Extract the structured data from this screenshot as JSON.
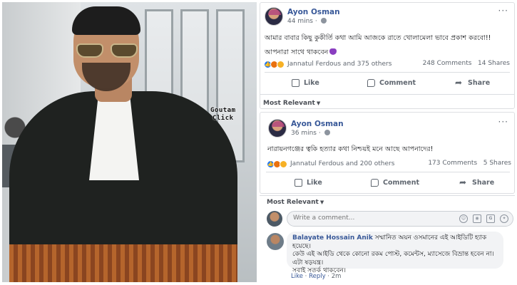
{
  "photo": {
    "watermark_line1": "Goutam",
    "watermark_line2": "Click"
  },
  "post1": {
    "author": "Ayon Osman",
    "time": "44 mins",
    "text_line1": "আমার বাবার কিছু কুকীর্তি কথা আমি আজকে রাতে খোলামেলা ভাবে প্রকাশ করবো!!",
    "text_line2": "আপনারা সাথে থাকবেন",
    "reactions_summary": "Jannatul Ferdous and 375 others",
    "comments_count": "248 Comments",
    "shares_count": "14 Shares",
    "actions": {
      "like": "Like",
      "comment": "Comment",
      "share": "Share"
    },
    "sort_label": "Most Relevant"
  },
  "post2": {
    "author": "Ayon Osman",
    "time": "36 mins",
    "text_line1": "নারায়নগঞ্জের ত্বকি হত্যার কথা নিশ্চয়ই মনে আছে আপনাদের!",
    "reactions_summary": "Jannatul Ferdous and 200 others",
    "comments_count": "173 Comments",
    "shares_count": "5 Shares",
    "actions": {
      "like": "Like",
      "comment": "Comment",
      "share": "Share"
    },
    "sort_label": "Most Relevant"
  },
  "composer": {
    "placeholder": "Write a comment..."
  },
  "comment": {
    "author": "Balayate Hossain Anik",
    "text_line1": "সম্মানিত অয়ন ওসমানের এই আইডিটি হ্যাক হয়েছে।",
    "text_line2": "কেউ এই আইডি থেকে কোনো রকম পোস্ট, কমেন্টস, ম্যাসেজে বিভ্রান্ত হবেন না।",
    "text_line3": "এটা ষড়যন্ত্র।",
    "text_line4": "সবাই সতর্ক থাকবেন।",
    "like_label": "Like",
    "reply_label": "Reply",
    "time": "2m"
  },
  "colors": {
    "link_blue": "#385898",
    "like_blue": "#2078f4",
    "muted_gray": "#606770",
    "heart_purple": "#8a3ec0"
  }
}
